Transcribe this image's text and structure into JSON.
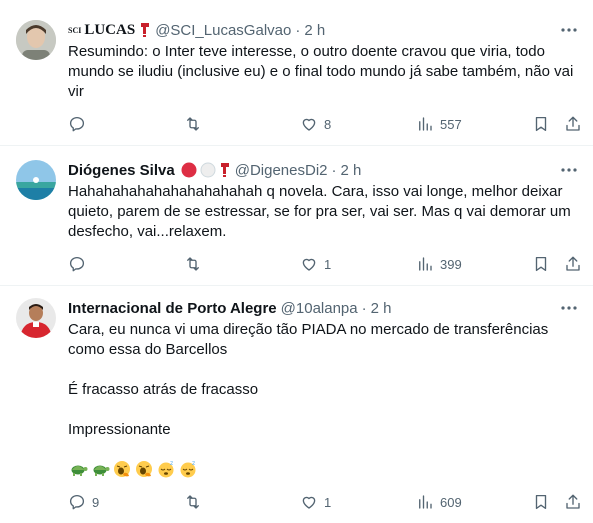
{
  "colors": {
    "text": "#0f1419",
    "muted": "#536471",
    "divider": "#eff3f4",
    "inter_red": "#d7262f"
  },
  "tweets": [
    {
      "name_prefix": "SCI",
      "name": "LUCAS",
      "handle": "@SCI_LucasGalvao",
      "dot": "·",
      "time": "2 h",
      "text": "Resumindo: o Inter teve interesse, o outro doente cravou que viria, todo mundo se iludiu (inclusive eu) e o final todo mundo já sabe também, não vai vir",
      "replies": "",
      "retweets": "",
      "likes": "8",
      "views": "557"
    },
    {
      "name": "Diógenes Silva",
      "handle": "@DigenesDi2",
      "dot": "·",
      "time": "2 h",
      "text": "Hahahahahahahahahahahah q novela. Cara, isso vai longe, melhor deixar quieto, parem de se estressar, se for pra ser, vai ser. Mas q vai demorar um desfecho, vai...relaxem.",
      "replies": "",
      "retweets": "",
      "likes": "1",
      "views": "399"
    },
    {
      "name": "Internacional de Porto Alegre",
      "handle": "@10alanpa",
      "dot": "·",
      "time": "2 h",
      "text": "Cara, eu nunca vi uma direção tão PIADA no mercado de transferências como essa do Barcellos\n\nÉ fracasso atrás de fracasso\n\nImpressionante",
      "emojis": [
        "turtle",
        "turtle",
        "yawning-face",
        "yawning-face",
        "sleeping-face",
        "sleeping-face"
      ],
      "replies": "9",
      "retweets": "",
      "likes": "1",
      "views": "609"
    }
  ]
}
